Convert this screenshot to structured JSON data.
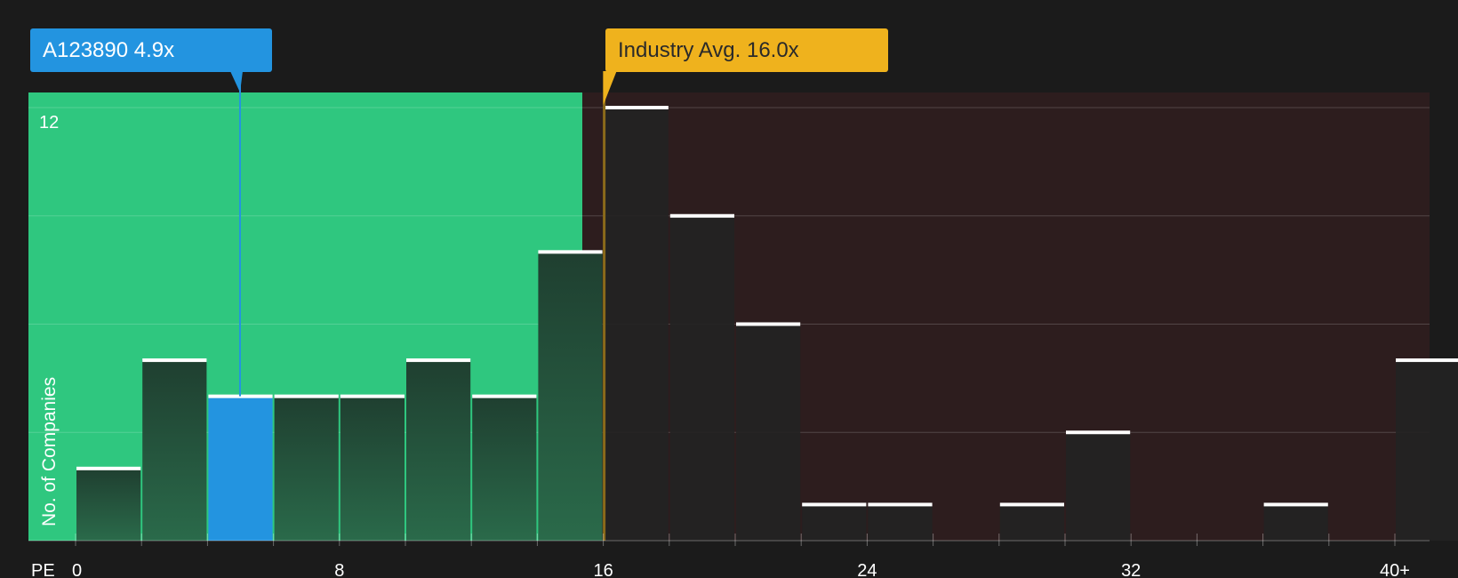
{
  "chart_data": {
    "type": "bar",
    "xlabel": "PE",
    "ylabel": "No. of Companies",
    "x_ticks": [
      "0",
      "8",
      "16",
      "24",
      "32",
      "40+"
    ],
    "y_ticks": [
      "12"
    ],
    "ylim": [
      0,
      12
    ],
    "bin_width": 2,
    "bins": [
      {
        "start": 0,
        "value": 2
      },
      {
        "start": 2,
        "value": 5
      },
      {
        "start": 4,
        "value": 4
      },
      {
        "start": 6,
        "value": 4
      },
      {
        "start": 8,
        "value": 4
      },
      {
        "start": 10,
        "value": 5
      },
      {
        "start": 12,
        "value": 4
      },
      {
        "start": 14,
        "value": 8
      },
      {
        "start": 16,
        "value": 12
      },
      {
        "start": 18,
        "value": 9
      },
      {
        "start": 20,
        "value": 6
      },
      {
        "start": 22,
        "value": 1
      },
      {
        "start": 24,
        "value": 1
      },
      {
        "start": 26,
        "value": 0
      },
      {
        "start": 28,
        "value": 1
      },
      {
        "start": 30,
        "value": 3
      },
      {
        "start": 32,
        "value": 0
      },
      {
        "start": 34,
        "value": 0
      },
      {
        "start": 36,
        "value": 1
      },
      {
        "start": 38,
        "value": 0
      },
      {
        "start": 40,
        "value": 5
      }
    ],
    "company": {
      "label": "A123890 4.9x",
      "pe": 4.9
    },
    "industry": {
      "label": "Industry Avg. 16.0x",
      "pe": 16.0
    },
    "grid": true,
    "colors": {
      "undervalued_zone": "#2fc77f",
      "overvalued_zone": "#2d1d1e",
      "company": "#2394e0",
      "industry": "#efb21d",
      "bar_cap": "#ffffff"
    }
  }
}
